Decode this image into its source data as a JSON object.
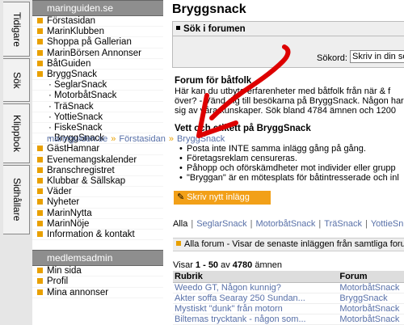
{
  "vtabs": [
    "Tidigare",
    "Sök",
    "Klippbok",
    "Sidhållare"
  ],
  "menu": {
    "site_title": "maringuiden.se",
    "items": [
      "Förstasidan",
      "MarinKlubben",
      "Shoppa på Gallerian",
      "MarinBörsen Annonser",
      "BåtGuiden",
      "BryggSnack"
    ],
    "sub_items": [
      "SeglarSnack",
      "MotorbåtSnack",
      "TräSnack",
      "YottieSnack",
      "FiskeSnack",
      "BryggSnack"
    ],
    "items2": [
      "GästHamnar",
      "Evenemangskalender",
      "Branschregistret",
      "Klubbar & Sällskap",
      "Väder",
      "Nyheter",
      "MarinNytta",
      "MarinNöje",
      "Information & kontakt"
    ],
    "section2_title": "medlemsadmin",
    "items3": [
      "Min sida",
      "Profil",
      "Mina annonser"
    ]
  },
  "breadcrumb": {
    "site": "maringuiden.se",
    "page1": "Förstasidan",
    "page2": "BryggSnack"
  },
  "main": {
    "title": "Bryggsnack",
    "search_title": "Sök i forumen",
    "search_label": "Sökord:",
    "search_value": "Skriv in din sö",
    "forum_title": "Forum för båtfolk",
    "forum_lines": [
      "Här kan du utbyta erfarenheter med båtfolk från när & f",
      "över? - Vänd dig till besökarna på BryggSnack. Någon har",
      "sig av våra kunskaper. Sök bland 4784 ämnen och 1200"
    ],
    "rules_title": "Vett och etikett på BryggSnack",
    "rules": [
      "Posta inte INTE samma inlägg gång på gång.",
      "Företagsreklam censureras.",
      "Påhopp och oförskämdheter mot individer eller grupp",
      "\"Bryggan\" är en mötesplats för båtintresserade och inl"
    ],
    "new_post": "Skriv nytt inlägg",
    "tabs": [
      "Alla",
      "SeglarSnack",
      "MotorbåtSnack",
      "TräSnack",
      "YottieSn"
    ],
    "all_bar": "Alla forum - Visar de senaste inläggen från samtliga forum",
    "count_prefix": "Visar ",
    "count_range": "1 - 50",
    "count_of": " av ",
    "count_total": "4780",
    "count_suffix": " ämnen",
    "columns": [
      "Rubrik",
      "Forum"
    ],
    "rows": [
      [
        "Weedo GT, Någon kunnig?",
        "MotorbåtSnack"
      ],
      [
        "Akter soffa Searay 250 Sundan...",
        "BryggSnack"
      ],
      [
        "Mystiskt \"dunk\" från motorn",
        "MotorbåtSnack"
      ],
      [
        "Biltemas trycktank - någon som...",
        "MotorbåtSnack"
      ]
    ]
  },
  "colors": {
    "accent": "#e8a000",
    "menu_header": "#8e8e8e",
    "arrow": "#dd0000"
  }
}
